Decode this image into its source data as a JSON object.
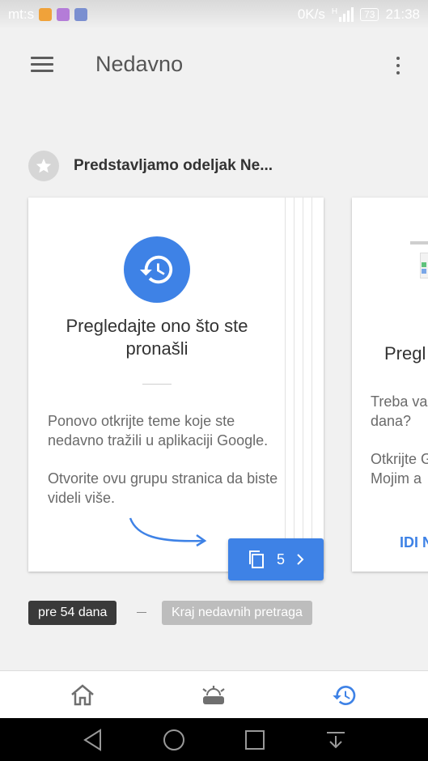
{
  "status_bar": {
    "carrier": "mt:s",
    "network_speed": "0K/s",
    "network_type": "H",
    "battery": "73",
    "time": "21:38"
  },
  "header": {
    "title": "Nedavno"
  },
  "section": {
    "title": "Predstavljamo odeljak Ne..."
  },
  "card1": {
    "heading": "Pregledajte ono što ste\npronašli",
    "body_1": "Ponovo otkrijte teme koje ste nedavno tražili u aplikaciji Google.",
    "body_2": "Otvorite ovu grupu stranica da biste videli više.",
    "button_count": "5"
  },
  "card2": {
    "heading_partial": "Pregl",
    "body_partial_1": "Treba va pronašli dana?",
    "body_partial_2": "Otkrijte Google Mojim a",
    "link_partial": "IDI N"
  },
  "timeline": {
    "time_chip": "pre 54 dana",
    "end_chip": "Kraj nedavnih pretraga"
  },
  "colors": {
    "accent": "#3e82e6",
    "nav_inactive": "#6f6f6f"
  },
  "bottom_nav": {
    "items": [
      "home-icon",
      "updates-icon",
      "recent-history-icon"
    ],
    "active": "recent-history-icon"
  }
}
